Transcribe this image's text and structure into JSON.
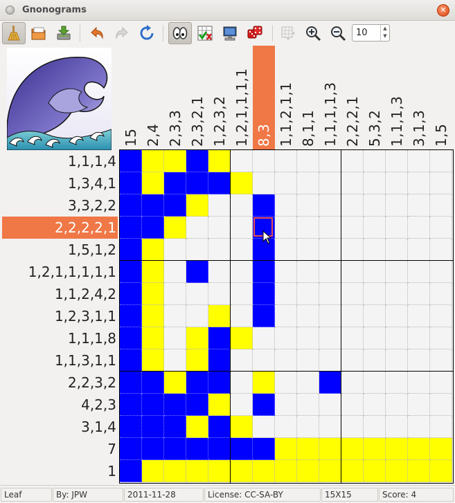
{
  "window": {
    "title": "Gnonograms"
  },
  "toolbar": {
    "buttons": [
      {
        "name": "broom-icon",
        "label": "Clear",
        "active": true
      },
      {
        "name": "open-folder-icon",
        "label": "Open"
      },
      {
        "name": "save-download-icon",
        "label": "Save"
      },
      {
        "name": "undo-icon",
        "label": "Undo"
      },
      {
        "name": "redo-icon",
        "label": "Redo",
        "disabled": true
      },
      {
        "name": "refresh-icon",
        "label": "Restart"
      },
      {
        "name": "eyes-icon",
        "label": "Peek",
        "active": true
      },
      {
        "name": "check-grid-icon",
        "label": "Check"
      },
      {
        "name": "computer-icon",
        "label": "Computer solve"
      },
      {
        "name": "dice-icon",
        "label": "Random"
      },
      {
        "name": "resize-grid-icon",
        "label": "Resize",
        "disabled": true
      },
      {
        "name": "zoom-in-icon",
        "label": "Zoom in"
      },
      {
        "name": "zoom-out-icon",
        "label": "Zoom out"
      }
    ],
    "zoom_value": "10"
  },
  "colors": {
    "filled": "#0000ff",
    "empty_marked": "#ffff00",
    "highlight": "#f07746",
    "unknown": "#f4f4f4"
  },
  "columns": [
    "15",
    "2,4",
    "2,3,3",
    "2,3,2,1",
    "1,2,3,2",
    "1,2,1,1,1,1",
    "8,3",
    "1,1,2,1,1",
    "8,1,1",
    "1,1,1,1,3",
    "2,2,2,1",
    "5,3,2",
    "1,1,1,3",
    "3,1,3",
    "1,5"
  ],
  "highlighted_column": 6,
  "rows": [
    "1,1,1,4",
    "1,3,4,1",
    "3,3,2,2",
    "2,2,2,2,1",
    "1,5,1,2",
    "1,2,1,1,1,1,1",
    "1,1,2,4,2",
    "1,2,3,1,1",
    "1,1,1,8",
    "1,1,3,1,1",
    "2,2,3,2",
    "4,2,3",
    "3,1,4",
    "7",
    "1"
  ],
  "highlighted_row": 3,
  "grid": [
    "BYYBY..........",
    "BYBBBY.........",
    "BBBY..B........",
    "BBY...B........",
    "BY....B........",
    "BY.B..B........",
    "BY....B........",
    "BY..Y.B........",
    "BY.YBY.........",
    "BY.YB..........",
    "BBYBB.Y..B.....",
    "BBBBY.B........",
    "BBBYBY.........",
    "BBBBBBBYYYYYYYY",
    "BYYYYYYYYYYYYYY"
  ],
  "cursor": {
    "row": 3,
    "col": 6
  },
  "status": {
    "name": "Leaf",
    "author": "By: JPW",
    "date": "2011-11-28",
    "license": "License: CC-SA-BY",
    "size": "15X15",
    "score": "Score: 4"
  }
}
